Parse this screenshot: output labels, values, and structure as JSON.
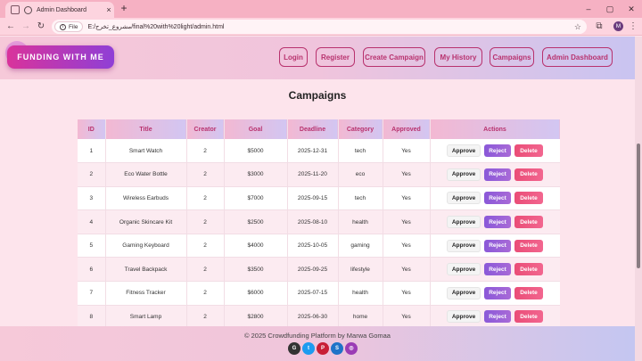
{
  "browser": {
    "tab_title": "Admin Dashboard",
    "url_chip": "File",
    "url": "E:/مشروع_تخرج/final%20with%20light/admin.html",
    "profile_initial": "M"
  },
  "navbar": {
    "logo": "FUNDING WITH ME",
    "links": [
      "Login",
      "Register",
      "Create Campaign",
      "My History",
      "Campaigns",
      "Admin Dashboard"
    ]
  },
  "page_title": "Campaigns",
  "table": {
    "headers": [
      "ID",
      "Title",
      "Creator",
      "Goal",
      "Deadline",
      "Category",
      "Approved",
      "Actions"
    ],
    "action_labels": {
      "approve": "Approve",
      "reject": "Reject",
      "delete": "Delete"
    },
    "rows": [
      [
        "1",
        "Smart Watch",
        "2",
        "$5000",
        "2025-12-31",
        "tech",
        "Yes"
      ],
      [
        "2",
        "Eco Water Bottle",
        "2",
        "$3000",
        "2025-11-20",
        "eco",
        "Yes"
      ],
      [
        "3",
        "Wireless Earbuds",
        "2",
        "$7000",
        "2025-09-15",
        "tech",
        "Yes"
      ],
      [
        "4",
        "Organic Skincare Kit",
        "2",
        "$2500",
        "2025-08-10",
        "health",
        "Yes"
      ],
      [
        "5",
        "Gaming Keyboard",
        "2",
        "$4000",
        "2025-10-05",
        "gaming",
        "Yes"
      ],
      [
        "6",
        "Travel Backpack",
        "2",
        "$3500",
        "2025-09-25",
        "lifestyle",
        "Yes"
      ],
      [
        "7",
        "Fitness Tracker",
        "2",
        "$6000",
        "2025-07-15",
        "health",
        "Yes"
      ],
      [
        "8",
        "Smart Lamp",
        "2",
        "$2800",
        "2025-06-30",
        "home",
        "Yes"
      ]
    ]
  },
  "footer": {
    "text": "© 2025 Crowdfunding Platform by Marwa Gomaa",
    "social_icons": [
      "github-icon",
      "twitter-icon",
      "pinterest-icon",
      "skype-icon",
      "instagram-icon"
    ]
  },
  "colors": {
    "accent": "#b8326e",
    "reject": "#8a58d8",
    "delete": "#ea4d77"
  }
}
